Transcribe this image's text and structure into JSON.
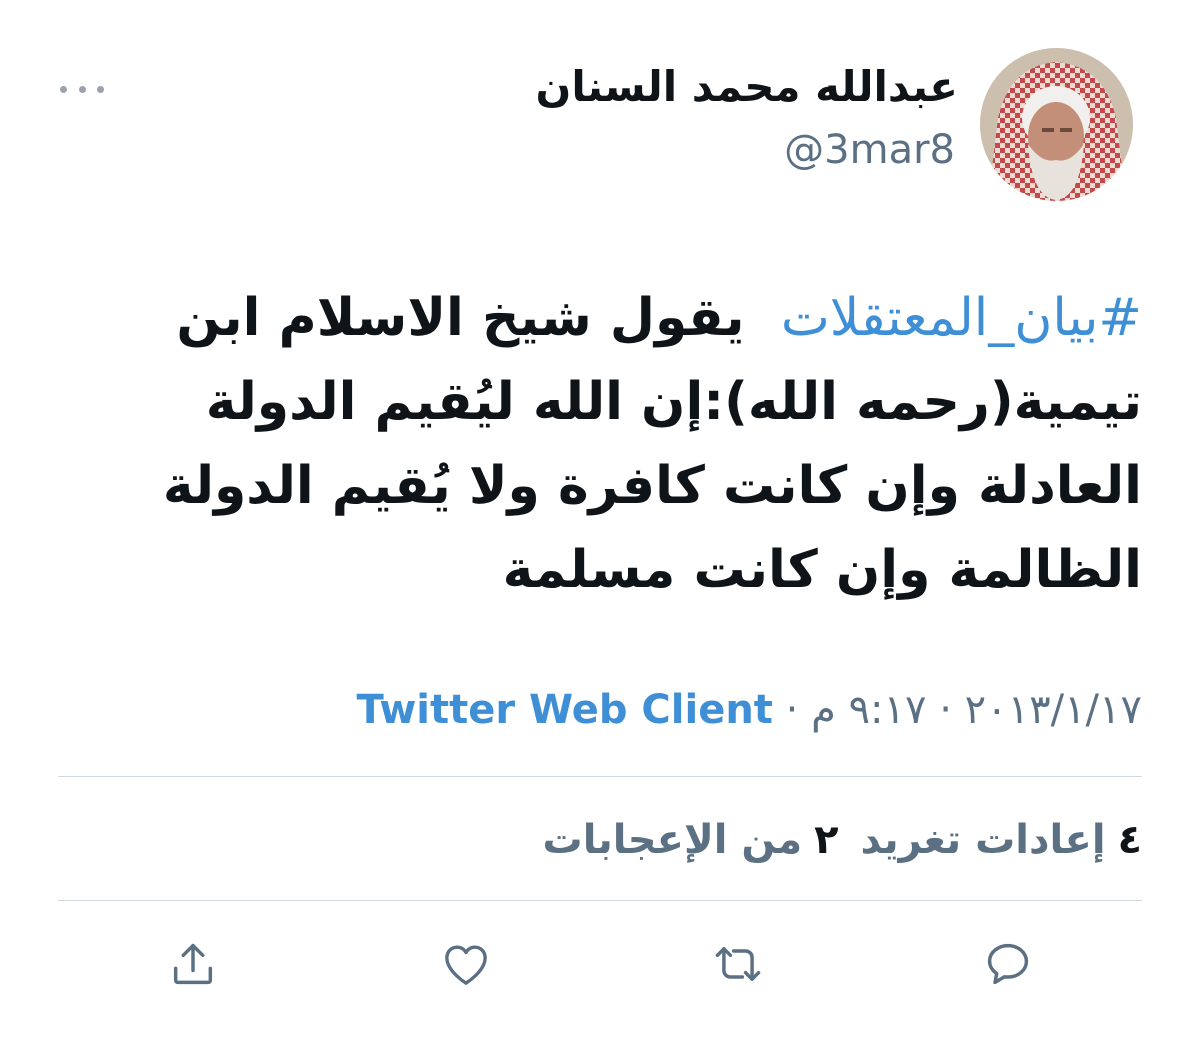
{
  "author": {
    "display_name": "عبدالله محمد السنان",
    "handle": "@3mar8"
  },
  "tweet": {
    "hashtag": "#بيان_المعتقلات",
    "text": "يقول شيخ الاسلام ابن تيمية(رحمه الله):إن الله ليُقيم الدولة العادلة وإن كانت كافرة ولا يُقيم الدولة الظالمة وإن كانت مسلمة"
  },
  "meta": {
    "date": "٢٠١٣/١/١٧",
    "separator": "·",
    "time": "٩:١٧ م",
    "source": "Twitter Web Client"
  },
  "stats": {
    "retweets_count": "٤",
    "retweets_label": "إعادات تغريد",
    "likes_count": "٢",
    "likes_label": "من الإعجابات"
  },
  "icons": {
    "more": "more-dots-icon",
    "reply": "reply-icon",
    "retweet": "retweet-icon",
    "like": "heart-icon",
    "share": "share-icon"
  },
  "colors": {
    "link": "#3f8fd6",
    "muted": "#5b7083",
    "text": "#0f1419",
    "divider": "#cfd9de"
  }
}
